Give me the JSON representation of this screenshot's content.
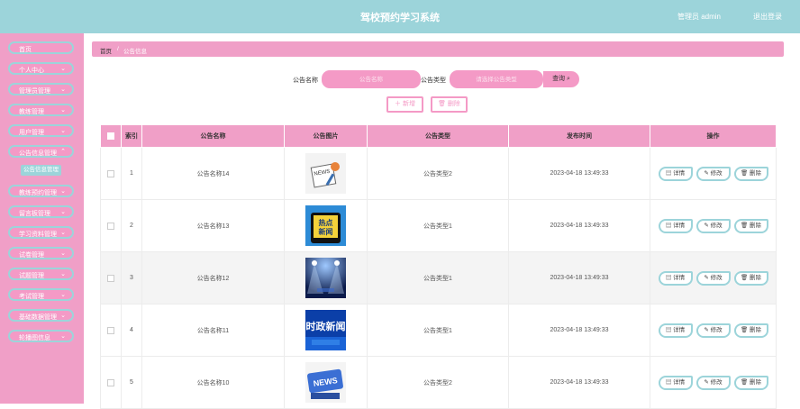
{
  "header": {
    "title": "驾校预约学习系统",
    "user": "管理员 admin",
    "logout": "退出登录"
  },
  "sidebar": {
    "items": [
      {
        "label": "首页",
        "chevron": false
      },
      {
        "label": "个人中心",
        "chevron": true
      },
      {
        "label": "管理员管理",
        "chevron": true
      },
      {
        "label": "教练管理",
        "chevron": true
      },
      {
        "label": "用户管理",
        "chevron": true
      },
      {
        "label": "公告信息管理",
        "chevron": true
      },
      {
        "label": "教练预约管理",
        "chevron": true
      },
      {
        "label": "留言板管理",
        "chevron": true
      },
      {
        "label": "学习资料管理",
        "chevron": true
      },
      {
        "label": "试卷管理",
        "chevron": true
      },
      {
        "label": "试题管理",
        "chevron": true
      },
      {
        "label": "考试管理",
        "chevron": true
      },
      {
        "label": "基础数据管理",
        "chevron": true
      },
      {
        "label": "轮播图信息",
        "chevron": true
      }
    ],
    "sub_item": "公告信息管理"
  },
  "breadcrumb": {
    "home": "首页",
    "sep": "/",
    "current": "公告信息"
  },
  "search": {
    "name_label": "公告名称",
    "name_placeholder": "公告名称",
    "type_label": "公告类型",
    "type_placeholder": "请选择公告类型",
    "button": "查询 ⌕"
  },
  "actions": {
    "add": "＋ 新增",
    "delete": "🗑 删除"
  },
  "table": {
    "headers": [
      "索引",
      "公告名称",
      "公告图片",
      "公告类型",
      "发布时间",
      "操作"
    ],
    "rows": [
      {
        "index": "1",
        "name": "公告名称14",
        "type": "公告类型2",
        "time": "2023-04-18 13:49:33",
        "image": "news-clipboard-icon"
      },
      {
        "index": "2",
        "name": "公告名称13",
        "type": "公告类型1",
        "time": "2023-04-18 13:49:33",
        "image": "hot-news-phone-icon"
      },
      {
        "index": "3",
        "name": "公告名称12",
        "type": "公告类型1",
        "time": "2023-04-18 13:49:33",
        "image": "stage-lights-icon"
      },
      {
        "index": "4",
        "name": "公告名称11",
        "type": "公告类型1",
        "time": "2023-04-18 13:49:33",
        "image": "political-news-icon"
      },
      {
        "index": "5",
        "name": "公告名称10",
        "type": "公告类型2",
        "time": "2023-04-18 13:49:33",
        "image": "news-key-icon"
      }
    ],
    "op_labels": {
      "detail": "▤ 详情",
      "edit": "✎ 修改",
      "delete": "🗑 删除"
    }
  },
  "colors": {
    "accent": "#9cd4da",
    "pink": "#f09fc7"
  }
}
